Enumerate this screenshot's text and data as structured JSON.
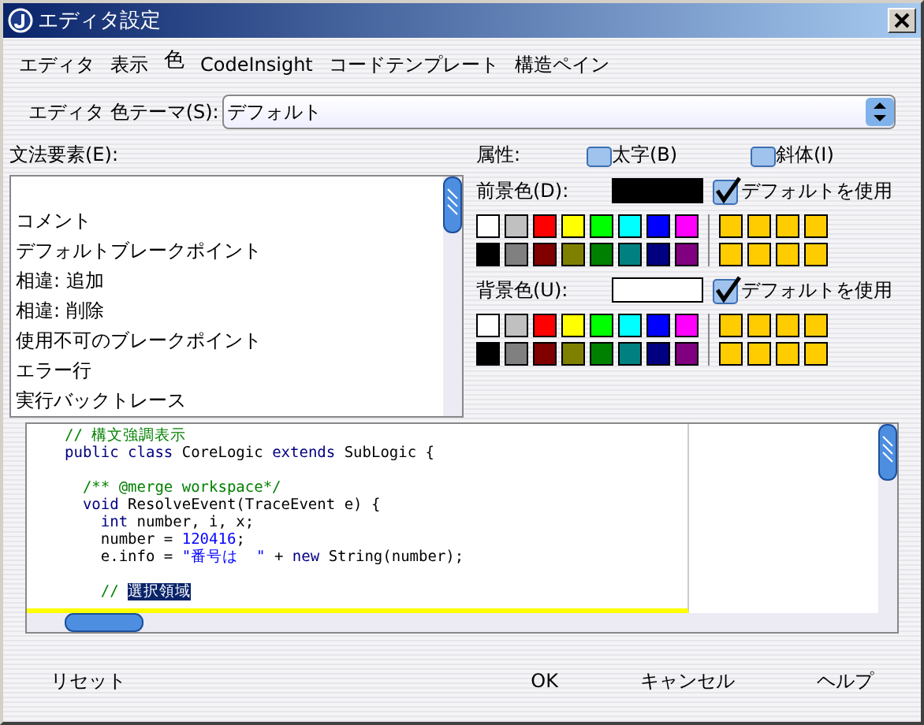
{
  "window": {
    "title": "エディタ設定"
  },
  "tabs": [
    {
      "label": "エディタ",
      "selected": false
    },
    {
      "label": "表示",
      "selected": false
    },
    {
      "label": "色",
      "selected": true
    },
    {
      "label": "CodeInsight",
      "selected": false
    },
    {
      "label": "コードテンプレート",
      "selected": false
    },
    {
      "label": "構造ペイン",
      "selected": false
    }
  ],
  "theme": {
    "label": "エディタ 色テーマ(S):",
    "value": "デフォルト"
  },
  "elements": {
    "label": "文法要素(E):",
    "items": [
      {
        "label": "コメント",
        "selected": false
      },
      {
        "label": "デフォルトブレークポイント",
        "selected": false
      },
      {
        "label": "相違: 追加",
        "selected": false
      },
      {
        "label": "相違: 削除",
        "selected": false
      },
      {
        "label": "使用不可のブレークポイント",
        "selected": false
      },
      {
        "label": "エラー行",
        "selected": false
      },
      {
        "label": "実行バックトレース",
        "selected": false
      }
    ]
  },
  "attributes": {
    "label": "属性:",
    "options": [
      {
        "label": "太字(B)",
        "checked": false
      },
      {
        "label": "斜体(I)",
        "checked": false
      }
    ]
  },
  "colors": [
    {
      "label": "前景色(D):",
      "color": "#000000",
      "use_default": {
        "label": "デフォルトを使用",
        "checked": true
      },
      "palette": [
        {
          "color": "#ffffff"
        },
        {
          "color": "#c0c0c0"
        },
        {
          "color": "#ff0000"
        },
        {
          "color": "#ffff00"
        },
        {
          "color": "#00ff00"
        },
        {
          "color": "#00ffff"
        },
        {
          "color": "#0000ff"
        },
        {
          "color": "#ff00ff"
        },
        {
          "color": "#000000"
        },
        {
          "color": "#808080"
        },
        {
          "color": "#800000"
        },
        {
          "color": "#808000"
        },
        {
          "color": "#008000"
        },
        {
          "color": "#008080"
        },
        {
          "color": "#000080"
        },
        {
          "color": "#800080"
        }
      ],
      "custom": [
        {
          "color": "#ffcc00"
        },
        {
          "color": "#ffcc00"
        },
        {
          "color": "#ffcc00"
        },
        {
          "color": "#ffcc00"
        },
        {
          "color": "#ffcc00"
        },
        {
          "color": "#ffcc00"
        },
        {
          "color": "#ffcc00"
        },
        {
          "color": "#ffcc00"
        }
      ]
    },
    {
      "label": "背景色(U):",
      "color": "#ffffff",
      "use_default": {
        "label": "デフォルトを使用",
        "checked": true
      },
      "palette": [
        {
          "color": "#ffffff"
        },
        {
          "color": "#c0c0c0"
        },
        {
          "color": "#ff0000"
        },
        {
          "color": "#ffff00"
        },
        {
          "color": "#00ff00"
        },
        {
          "color": "#00ffff"
        },
        {
          "color": "#0000ff"
        },
        {
          "color": "#ff00ff"
        },
        {
          "color": "#000000"
        },
        {
          "color": "#808080"
        },
        {
          "color": "#800000"
        },
        {
          "color": "#808000"
        },
        {
          "color": "#008000"
        },
        {
          "color": "#008080"
        },
        {
          "color": "#000080"
        },
        {
          "color": "#800080"
        }
      ],
      "custom": [
        {
          "color": "#ffcc00"
        },
        {
          "color": "#ffcc00"
        },
        {
          "color": "#ffcc00"
        },
        {
          "color": "#ffcc00"
        },
        {
          "color": "#ffcc00"
        },
        {
          "color": "#ffcc00"
        },
        {
          "color": "#ffcc00"
        },
        {
          "color": "#ffcc00"
        }
      ]
    }
  ],
  "preview": {
    "lines": [
      {
        "kind": "code",
        "tokens": [
          {
            "kind": "comment",
            "text": "// 構文強調表示"
          }
        ]
      },
      {
        "kind": "code",
        "tokens": [
          {
            "kind": "keyword",
            "text": "public class"
          },
          {
            "kind": "plain",
            "text": " CoreLogic "
          },
          {
            "kind": "keyword",
            "text": "extends"
          },
          {
            "kind": "plain",
            "text": " SubLogic {"
          }
        ]
      },
      {
        "kind": "blank"
      },
      {
        "kind": "code",
        "tokens": [
          {
            "kind": "comment",
            "text": "  /** @merge workspace*/"
          }
        ]
      },
      {
        "kind": "code",
        "tokens": [
          {
            "kind": "keyword",
            "text": "  void"
          },
          {
            "kind": "plain",
            "text": " ResolveEvent(TraceEvent e) {"
          }
        ]
      },
      {
        "kind": "code",
        "tokens": [
          {
            "kind": "keyword",
            "text": "    int"
          },
          {
            "kind": "plain",
            "text": " number, i, x;"
          }
        ]
      },
      {
        "kind": "code",
        "tokens": [
          {
            "kind": "plain",
            "text": "    number = "
          },
          {
            "kind": "number",
            "text": "120416"
          },
          {
            "kind": "plain",
            "text": ";"
          }
        ]
      },
      {
        "kind": "code",
        "tokens": [
          {
            "kind": "plain",
            "text": "    e.info = "
          },
          {
            "kind": "string",
            "text": "\"番号は  \""
          },
          {
            "kind": "plain",
            "text": " + "
          },
          {
            "kind": "keyword",
            "text": "new"
          },
          {
            "kind": "plain",
            "text": " String(number);"
          }
        ]
      },
      {
        "kind": "blank"
      },
      {
        "kind": "code",
        "tokens": [
          {
            "kind": "comment",
            "text": "    // "
          },
          {
            "kind": "selection",
            "text": "選択領域"
          }
        ]
      }
    ]
  },
  "buttons": [
    {
      "label": "リセット",
      "kind": "left"
    },
    {
      "label": "OK",
      "kind": "right"
    },
    {
      "label": "キャンセル",
      "kind": "right"
    },
    {
      "label": "ヘルプ",
      "kind": "right"
    }
  ]
}
